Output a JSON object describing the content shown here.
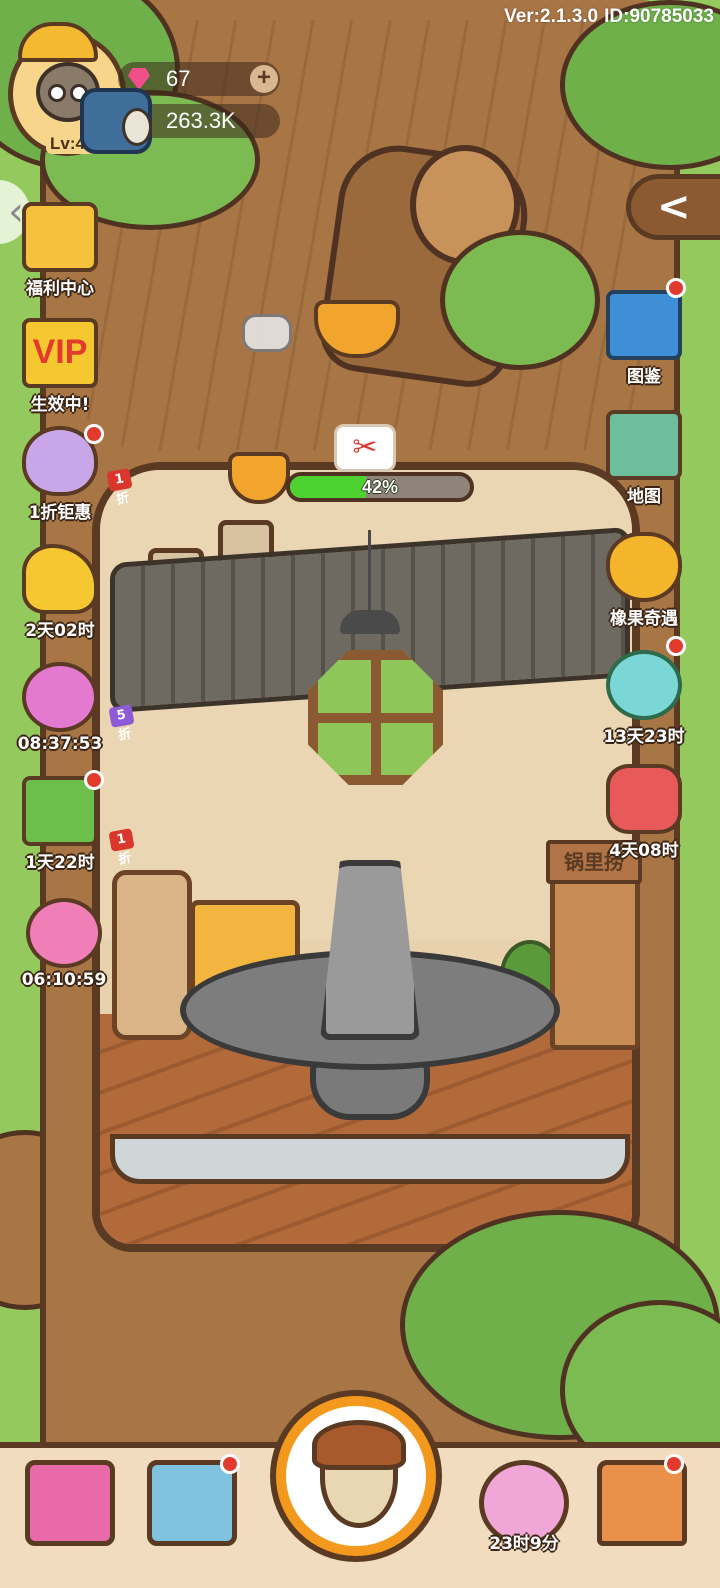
{
  "header": {
    "version": "Ver:2.1.3.0",
    "id": "ID:90785033"
  },
  "player": {
    "level": "Lv:47",
    "gems": "67",
    "acorns": "263.3K"
  },
  "left_menu": [
    {
      "label": "福利中心",
      "icon": "gift-icon",
      "dot": false,
      "tag": ""
    },
    {
      "label": "生效中!",
      "icon": "vip-icon",
      "icon_text": "VIP",
      "dot": false,
      "tag": ""
    },
    {
      "label": "1折钜惠",
      "icon": "egg-clock-icon",
      "dot": true,
      "tag": "1折"
    },
    {
      "label": "2天02时",
      "icon": "magic-lamp-icon",
      "dot": false,
      "tag": ""
    },
    {
      "label": "08:37:53",
      "icon": "alarm-clock-icon",
      "dot": false,
      "tag": "5折"
    },
    {
      "label": "1天22时",
      "icon": "basket-icon",
      "dot": true,
      "tag": "1折"
    },
    {
      "label": "06:10:59",
      "icon": "piggy-bank-icon",
      "dot": false,
      "tag": ""
    }
  ],
  "right_menu": [
    {
      "label": "图鉴",
      "icon": "book-icon",
      "dot": true
    },
    {
      "label": "地图",
      "icon": "map-icon",
      "dot": false
    },
    {
      "label": "橡果奇遇",
      "icon": "acorn-icon",
      "dot": false
    },
    {
      "label": "13天23时",
      "icon": "potion-icon",
      "dot": true
    },
    {
      "label": "4天08时",
      "icon": "candy-icon",
      "dot": false
    }
  ],
  "room": {
    "progress_percent": 42,
    "progress_text": "42%",
    "door_sign": "锅里捞",
    "scissor_glyph": "✂"
  },
  "bottom_bar": [
    {
      "label": "",
      "icon": "shop-icon",
      "dot": false
    },
    {
      "label": "",
      "icon": "card-icon",
      "dot": true
    },
    {
      "label": "",
      "icon": "acorn-main-icon",
      "dot": false
    },
    {
      "label": "23时9分",
      "icon": "sakura-tree-icon",
      "dot": false
    },
    {
      "label": "",
      "icon": "house-icon",
      "dot": true
    }
  ],
  "glyphs": {
    "back_arrow": "‹",
    "collapse_arrow": "<",
    "plus": "+"
  },
  "colors": {
    "progress_fill": "#4ed22f",
    "notification_dot": "#e23b2e",
    "tag_red": "#d9362c",
    "tag_purple": "#8f5ad6"
  }
}
